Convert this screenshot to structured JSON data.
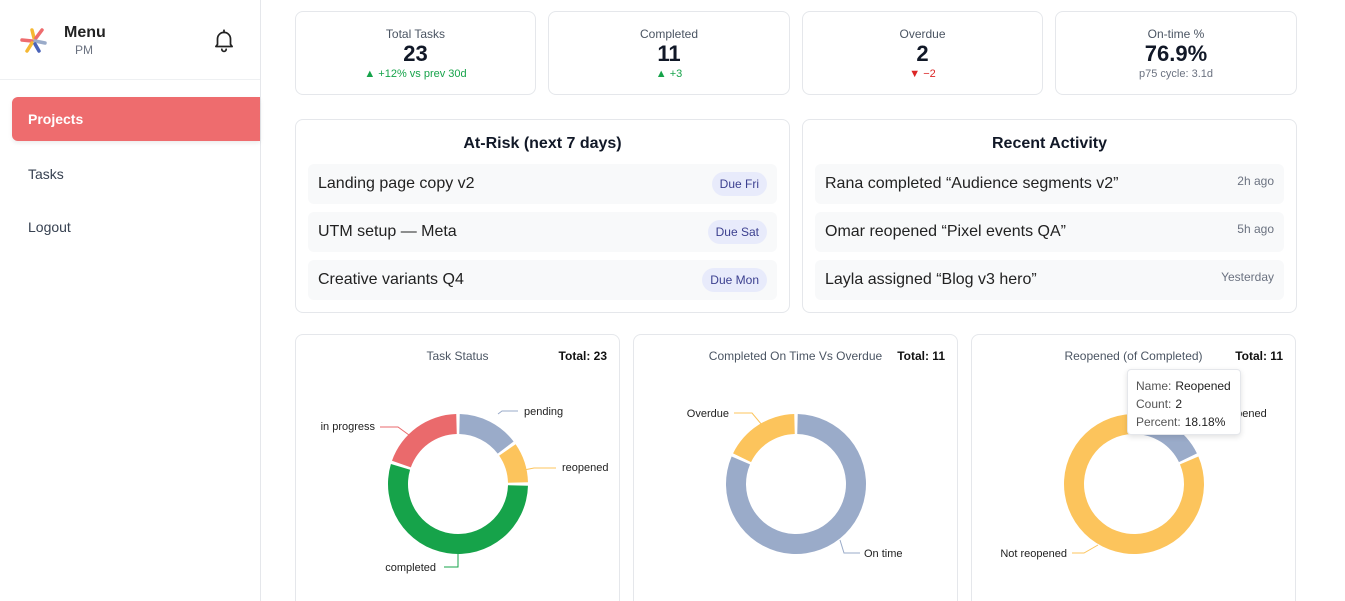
{
  "brand": {
    "title": "Menu",
    "subtitle": "PM"
  },
  "nav": [
    {
      "label": "Projects",
      "active": true
    },
    {
      "label": "Tasks"
    },
    {
      "label": "Logout"
    }
  ],
  "stats": [
    {
      "label": "Total Tasks",
      "value": "23",
      "delta": "▲ +12% vs prev 30d",
      "trend": "up"
    },
    {
      "label": "Completed",
      "value": "11",
      "delta": "▲ +3",
      "trend": "up"
    },
    {
      "label": "Overdue",
      "value": "2",
      "delta": "▼ −2",
      "trend": "down"
    },
    {
      "label": "On-time %",
      "value": "76.9%",
      "delta": "p75 cycle: 3.1d",
      "trend": "neutral"
    }
  ],
  "at_risk": {
    "title": "At-Risk (next 7 days)",
    "items": [
      {
        "name": "Landing page copy v2",
        "due": "Due Fri"
      },
      {
        "name": "UTM setup — Meta",
        "due": "Due Sat"
      },
      {
        "name": "Creative variants Q4",
        "due": "Due Mon"
      }
    ]
  },
  "activity": {
    "title": "Recent Activity",
    "items": [
      {
        "text": "Rana completed “Audience segments v2”",
        "time": "2h ago"
      },
      {
        "text": "Omar reopened “Pixel events QA”",
        "time": "5h ago"
      },
      {
        "text": "Layla assigned “Blog v3 hero”",
        "time": "Yesterday"
      }
    ]
  },
  "colors": {
    "accent": "#ee6c6e",
    "pending": "#9aabc9",
    "reopened": "#fcc45c",
    "completed": "#16a34a",
    "in_progress": "#ea6a6c",
    "on_time": "#9aabc9",
    "overdue": "#fcc45c",
    "not_reopened": "#fcc45c"
  },
  "chart_data": [
    {
      "type": "pie",
      "title": "Task Status",
      "total_label": "Total: 23",
      "slices": [
        {
          "name": "pending",
          "value": 3,
          "color": "#9aabc9"
        },
        {
          "name": "reopened",
          "value": 2,
          "color": "#fcc45c"
        },
        {
          "name": "completed",
          "value": 11,
          "color": "#16a34a"
        },
        {
          "name": "in progress",
          "value": 4,
          "color": "#ea6a6c"
        }
      ]
    },
    {
      "type": "pie",
      "title": "Completed On Time Vs Overdue",
      "total_label": "Total: 11",
      "slices": [
        {
          "name": "On time",
          "value": 9,
          "color": "#9aabc9"
        },
        {
          "name": "Overdue",
          "value": 2,
          "color": "#fcc45c"
        }
      ]
    },
    {
      "type": "pie",
      "title": "Reopened (of Completed)",
      "total_label": "Total: 11",
      "slices": [
        {
          "name": "Reopened",
          "value": 2,
          "color": "#9aabc9"
        },
        {
          "name": "Not reopened",
          "value": 9,
          "color": "#fcc45c"
        }
      ],
      "tooltip": {
        "name_label": "Name:",
        "name": "Reopened",
        "count_label": "Count:",
        "count": "2",
        "percent_label": "Percent:",
        "percent": "18.18%"
      }
    }
  ]
}
